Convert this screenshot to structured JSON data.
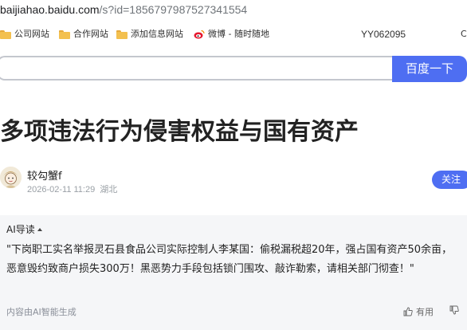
{
  "browser": {
    "url_host": "baijiahao.baidu.com",
    "url_rest": "/s?id=1856797987527341554",
    "bookmarks": [
      {
        "label": "公司网站",
        "icon": "folder-icon"
      },
      {
        "label": "合作网站",
        "icon": "folder-icon"
      },
      {
        "label": "添加信息网站",
        "icon": "folder-icon"
      },
      {
        "label": "微博 - 随时随地",
        "icon": "weibo-icon"
      }
    ],
    "extension_label": "YY062095",
    "extension2_label": "C"
  },
  "search": {
    "button_label": "百度一下",
    "placeholder": ""
  },
  "article": {
    "title": "多项违法行为侵害权益与国有资产",
    "author": "较勾蟹f",
    "date": "2026-02-11 11:29",
    "location": "湖北",
    "follow_label": "关注"
  },
  "ai_summary": {
    "heading": "AI导读",
    "text": "\"下岗职工实名举报灵石县食品公司实际控制人李某国：偷税漏税超20年，强占国有资产50余亩，恶意毁约致商户损失300万！黑恶势力手段包括锁门围攻、敲诈勒索，请相关部门彻查！\"",
    "footer": "内容由AI智能生成",
    "useful_label": "有用"
  },
  "colors": {
    "accent": "#4e6ef2",
    "ai_bg": "#f5f6f8"
  }
}
